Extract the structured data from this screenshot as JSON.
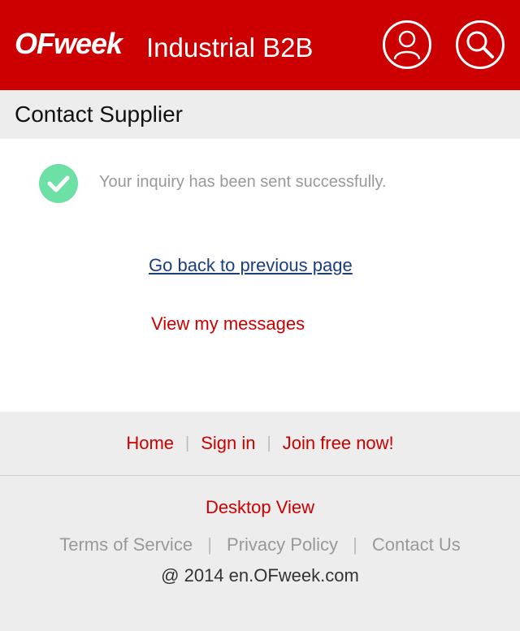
{
  "header": {
    "logo": "OFweek",
    "title": "Industrial B2B",
    "icons": {
      "user": "user-icon",
      "search": "search-icon"
    }
  },
  "section": {
    "title": "Contact Supplier"
  },
  "content": {
    "success_message": "Your inquiry has been sent successfully.",
    "back_link": "Go back to previous page",
    "messages_link": "View my messages"
  },
  "footer": {
    "nav": [
      "Home",
      "Sign in",
      "Join free now!"
    ],
    "separator": "|",
    "desktop_view": "Desktop View",
    "legal": [
      "Terms of Service",
      "Privacy Policy",
      "Contact Us"
    ],
    "copyright": "@ 2014 en.OFweek.com"
  },
  "colors": {
    "brand_red": "#cc0000",
    "success_green": "#6de0a6",
    "link_blue": "#1a3f7a"
  }
}
